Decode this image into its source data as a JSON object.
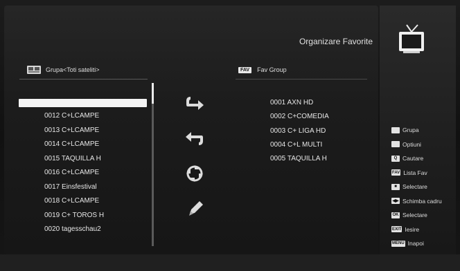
{
  "header": {
    "title": "Organizare Favorite",
    "tv_icon": "tv-icon"
  },
  "left_panel": {
    "group_label": "Grupa<Toti sateliti>",
    "channels": [
      "0012 C+LCAMPE",
      "0013 C+LCAMPE",
      "0014 C+LCAMPE",
      "0015 TAQUILLA H",
      "0016 C+LCAMPE",
      "0017 Einsfestival",
      "0018 C+LCAMPE",
      "0019 C+ TOROS H",
      "0020 tagesschau2"
    ]
  },
  "actions": [
    {
      "name": "add-to-fav",
      "icon": "arrow-right-icon"
    },
    {
      "name": "remove-from-fav",
      "icon": "arrow-left-icon"
    },
    {
      "name": "move",
      "icon": "move-icon"
    },
    {
      "name": "rename",
      "icon": "pencil-icon"
    }
  ],
  "fav_panel": {
    "badge": "FAV",
    "group_label": "Fav Group",
    "items": [
      "0001 AXN HD",
      "0002 C+COMEDIA",
      "0003 C+ LIGA HD",
      "0004 C+L MULTI",
      "0005 TAQUILLA H"
    ]
  },
  "legend": [
    {
      "key": "",
      "label": "Grupa",
      "color": "#e2e2e2"
    },
    {
      "key": "",
      "label": "Optiuni",
      "color": "#e2e2e2"
    },
    {
      "key": "Q",
      "label": "Cautare",
      "color": "#e2e2e2"
    },
    {
      "key": "FAV",
      "label": "Lista Fav",
      "color": "#e2e2e2"
    },
    {
      "key": "■",
      "label": "Selectare",
      "color": "#e2e2e2"
    },
    {
      "key": "◀▶",
      "label": "Schimba cadru",
      "color": "#e2e2e2"
    },
    {
      "key": "OK",
      "label": "Selectare",
      "color": "#e2e2e2"
    },
    {
      "key": "EXIT",
      "label": "Iesire",
      "color": "#e2e2e2"
    },
    {
      "key": "MENU",
      "label": "Inapoi",
      "color": "#e2e2e2"
    }
  ]
}
